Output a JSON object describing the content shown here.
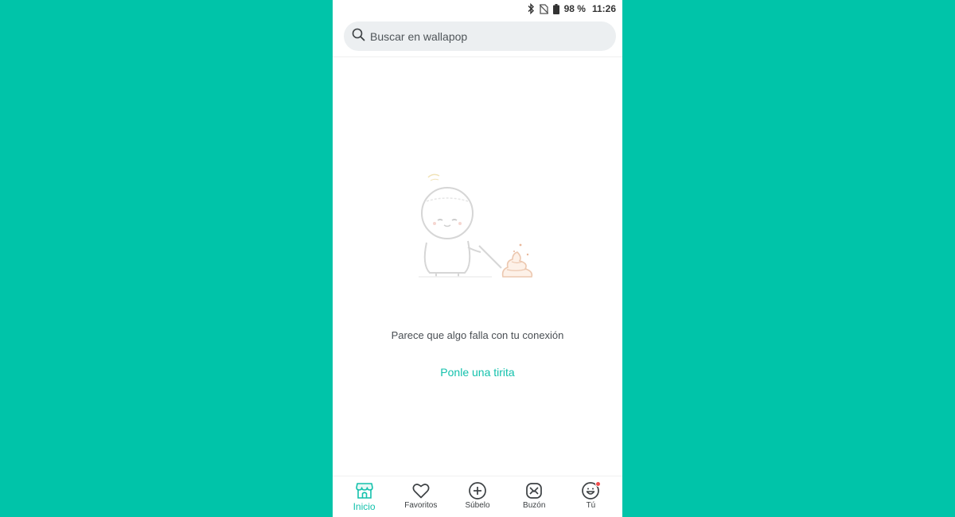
{
  "status_bar": {
    "battery": "98 %",
    "time": "11:26",
    "icons": [
      "bluetooth-icon",
      "no-sim-icon",
      "battery-icon"
    ]
  },
  "search": {
    "placeholder": "Buscar en wallapop",
    "icon": "search-icon"
  },
  "empty_state": {
    "illustration": "sad-person-with-poop-illustration",
    "message": "Parece que algo falla con tu conexión",
    "action_label": "Ponle una tirita"
  },
  "bottom_nav": {
    "items": [
      {
        "label": "Inicio",
        "icon": "store-icon",
        "active": true
      },
      {
        "label": "Favoritos",
        "icon": "heart-icon"
      },
      {
        "label": "Súbelo",
        "icon": "plus-circle-icon"
      },
      {
        "label": "Buzón",
        "icon": "mail-icon"
      },
      {
        "label": "Tú",
        "icon": "profile-icon",
        "badge": true
      }
    ]
  },
  "colors": {
    "background": "#00c4a9",
    "accent": "#13c1ac",
    "badge": "#f04c4c"
  }
}
